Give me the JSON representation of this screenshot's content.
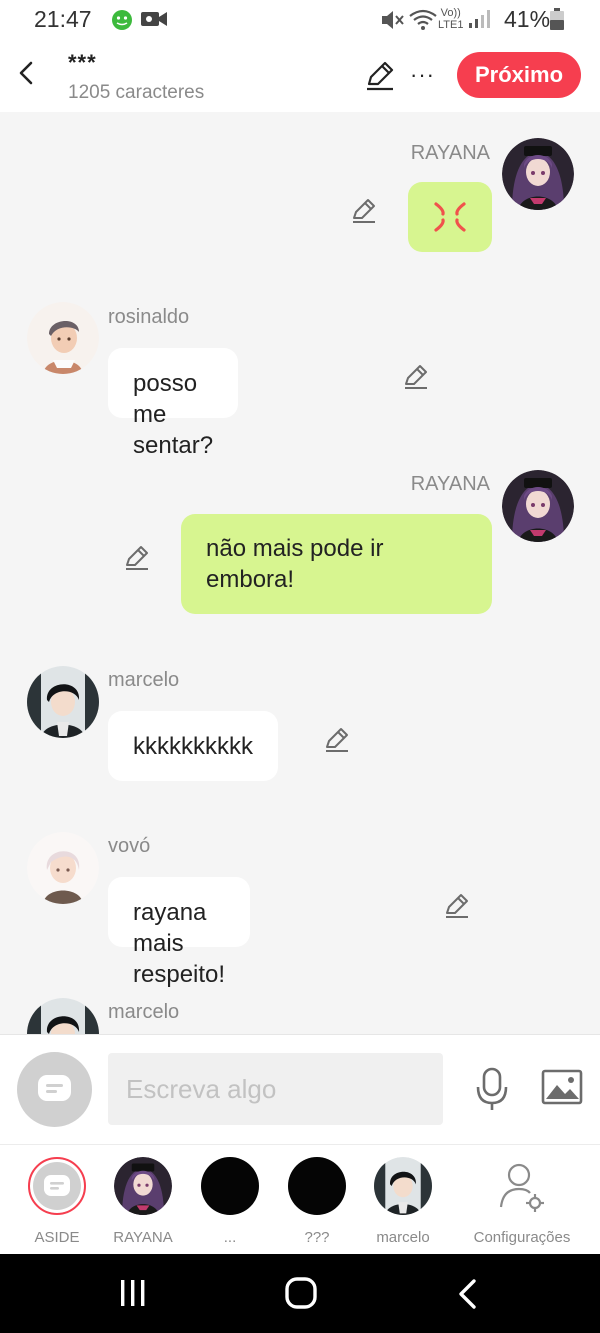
{
  "status_bar": {
    "time": "21:47",
    "volte_top": "Vo))",
    "volte_bottom": "LTE1",
    "battery": "41%"
  },
  "header": {
    "title": "***",
    "subtitle": "1205 caracteres",
    "next_label": "Próximo"
  },
  "messages": [
    {
      "side": "right",
      "name": "RAYANA",
      "text": "",
      "emoji": "anger-symbol"
    },
    {
      "side": "left",
      "name": "rosinaldo",
      "text": "posso me sentar?"
    },
    {
      "side": "right",
      "name": "RAYANA",
      "text": "não mais pode ir embora!"
    },
    {
      "side": "left",
      "name": "marcelo",
      "text": "kkkkkkkkkk"
    },
    {
      "side": "left",
      "name": "vovó",
      "text": "rayana mais respeito!"
    },
    {
      "side": "left",
      "name": "marcelo",
      "text": ""
    }
  ],
  "input": {
    "placeholder": "Escreva algo"
  },
  "characters": [
    {
      "label": "ASIDE"
    },
    {
      "label": "RAYANA"
    },
    {
      "label": "..."
    },
    {
      "label": "???"
    },
    {
      "label": "marcelo"
    },
    {
      "label": "Configurações"
    }
  ],
  "colors": {
    "accent": "#f63e4f",
    "bubble_right": "#d7f590",
    "bubble_left": "#ffffff",
    "background": "#f5f5f5",
    "anger": "#f0524c"
  }
}
